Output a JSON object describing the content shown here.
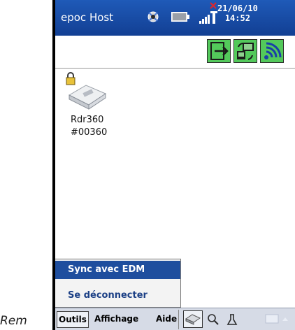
{
  "caption": {
    "text": "Rem"
  },
  "titlebar": {
    "app_title": "epoc Host",
    "date": "21/06/10",
    "time": "14:52",
    "icons": [
      "sync-icon",
      "battery-icon",
      "signal-icon",
      "no-network-icon"
    ]
  },
  "toolbar": {
    "buttons": [
      "exit-icon",
      "host-sync-icon",
      "wireless-icon"
    ]
  },
  "device": {
    "name": "Rdr360",
    "serial": "#00360",
    "icons": [
      "lock-icon",
      "reader-icon"
    ]
  },
  "menu_popup": {
    "items": [
      {
        "label": "Sync avec EDM",
        "selected": true
      },
      {
        "label": "Se déconnecter",
        "selected": false
      }
    ]
  },
  "menubar": {
    "items": [
      "Outils",
      "Affichage",
      "Aide"
    ],
    "icons": [
      "reader-icon",
      "zoom-icon",
      "test-tube-icon",
      "keyboard-icon"
    ]
  },
  "colors": {
    "titlebar": "#1a4ea6",
    "selection": "#1e4e9e",
    "button_green": "#53c95b",
    "menubar": "#d6dbe6"
  }
}
